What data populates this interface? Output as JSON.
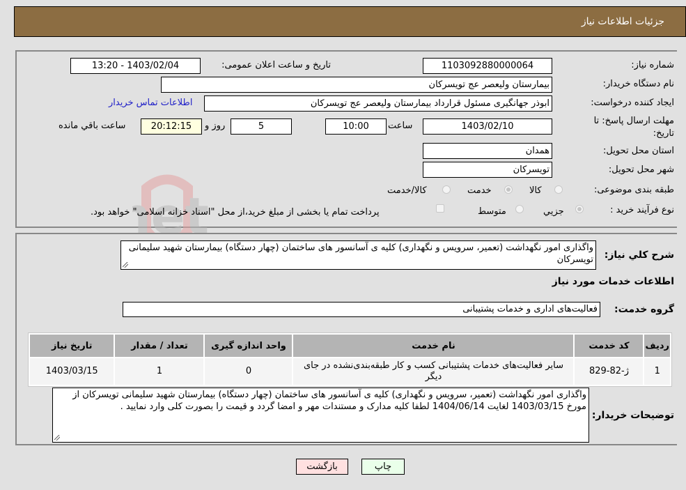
{
  "header": {
    "title": "جزئیات اطلاعات نیاز"
  },
  "fields": {
    "need_number": {
      "label": "شماره نیاز:",
      "value": "1103092880000064"
    },
    "announce_datetime": {
      "label": "تاریخ و ساعت اعلان عمومی:",
      "value": "1403/02/04 - 13:20"
    },
    "buyer_org": {
      "label": "نام دستگاه خریدار:",
      "value": "بیمارستان ولیعصر  عج  تویسرکان"
    },
    "requester": {
      "label": "ایجاد کننده درخواست:",
      "value": "ابوذر جهانگیری مسئول قرارداد بیمارستان ولیعصر  عج  تویسرکان"
    },
    "buyer_contact_link": "اطلاعات تماس خریدار",
    "deadline": {
      "label_line1": "مهلت ارسال پاسخ: تا",
      "label_line2": "تاریخ:",
      "date": "1403/02/10",
      "time_label": "ساعت",
      "time": "10:00",
      "days": "5",
      "days_label": "روز و",
      "remaining": "20:12:15",
      "remaining_label": "ساعت باقي مانده"
    },
    "province": {
      "label": "استان محل تحویل:",
      "value": "همدان"
    },
    "city": {
      "label": "شهر محل تحویل:",
      "value": "تویسرکان"
    },
    "category": {
      "label": "طبقه بندی موضوعی:",
      "options": [
        {
          "label": "کالا",
          "checked": false
        },
        {
          "label": "خدمت",
          "checked": true
        },
        {
          "label": "کالا/خدمت",
          "checked": false
        }
      ]
    },
    "purchase_type": {
      "label": "نوع فرآیند خرید :",
      "options": [
        {
          "label": "جزيي",
          "checked": true
        },
        {
          "label": "متوسط",
          "checked": false
        }
      ],
      "treasury_checkbox_label": "پرداخت تمام یا بخشی از مبلغ خرید،از محل \"اسناد خزانه اسلامی\" خواهد بود.",
      "treasury_checked": false
    }
  },
  "summary": {
    "label": "شرح کلي نیاز:",
    "value": "واگذاری امور نگهداشت (تعمیر، سرویس و نگهداری) کلیه ی آسانسور های ساختمان (چهار دستگاه) بیمارستان شهید سلیمانی تویسرکان"
  },
  "services_section": {
    "title": "اطلاعات خدمات مورد نیاز",
    "group_label": "گروه خدمت:",
    "group_value": "فعالیت‌های اداری و خدمات پشتیبانی"
  },
  "table": {
    "columns": [
      "ردیف",
      "کد خدمت",
      "نام خدمت",
      "واحد اندازه گیری",
      "تعداد / مقدار",
      "تاریخ نیاز"
    ],
    "rows": [
      [
        "1",
        "ژ-82-829",
        "سایر فعالیت‌های خدمات پشتیبانی کسب و کار طبقه‌بندی‌نشده در جای دیگر",
        "0",
        "1",
        "1403/03/15"
      ]
    ]
  },
  "buyer_notes": {
    "label": "توضیحات خریدار:",
    "value": "واگذاری امور نگهداشت (تعمیر، سرویس و نگهداری) کلیه ی آسانسور های ساختمان (چهار دستگاه) بیمارستان شهید سلیمانی تویسرکان از مورخ 1403/03/15 لغایت 1404/06/14 لطفا کلیه مدارک و مستندات مهر و امضا گردد و قیمت را بصورت کلی وارد نمایید ."
  },
  "buttons": {
    "print": "چاپ",
    "back": "بازگشت"
  },
  "watermark": {
    "text": "AriaTender.net"
  },
  "colors": {
    "header_bg": "#8c6d42",
    "link": "#2121c8",
    "print_bg": "#eaffea",
    "back_bg": "#ffe0e0",
    "remaining_bg": "#ffffe0"
  }
}
